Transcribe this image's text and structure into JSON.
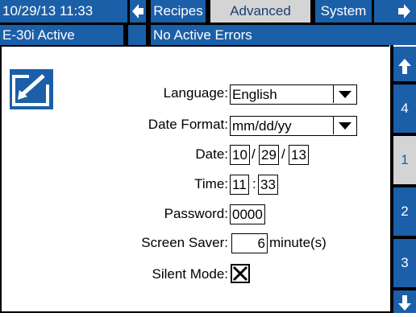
{
  "header": {
    "datetime": "10/29/13 11:33",
    "tabs": [
      {
        "label": "Recipes"
      },
      {
        "label": "Advanced"
      },
      {
        "label": "System"
      }
    ],
    "active_tab": "Advanced"
  },
  "status": {
    "active_model": "E-30i Active",
    "errors": "No Active Errors"
  },
  "form": {
    "language_label": "Language:",
    "language_value": "English",
    "date_format_label": "Date Format:",
    "date_format_value": "mm/dd/yy",
    "date_label": "Date:",
    "date_month": "10",
    "date_day": "29",
    "date_year": "13",
    "date_sep": "/",
    "time_label": "Time:",
    "time_hour": "11",
    "time_minute": "33",
    "time_sep": ":",
    "password_label": "Password:",
    "password_value": "0000",
    "screen_saver_label": "Screen Saver:",
    "screen_saver_value": "6",
    "screen_saver_unit": "minute(s)",
    "silent_mode_label": "Silent Mode:",
    "silent_mode_checked": true
  },
  "sidebar": {
    "pages": [
      "4",
      "1",
      "2",
      "3"
    ],
    "active_page": "1"
  },
  "colors": {
    "accent": "#1b5fa8",
    "active_tab_bg": "#d4d4d4"
  }
}
